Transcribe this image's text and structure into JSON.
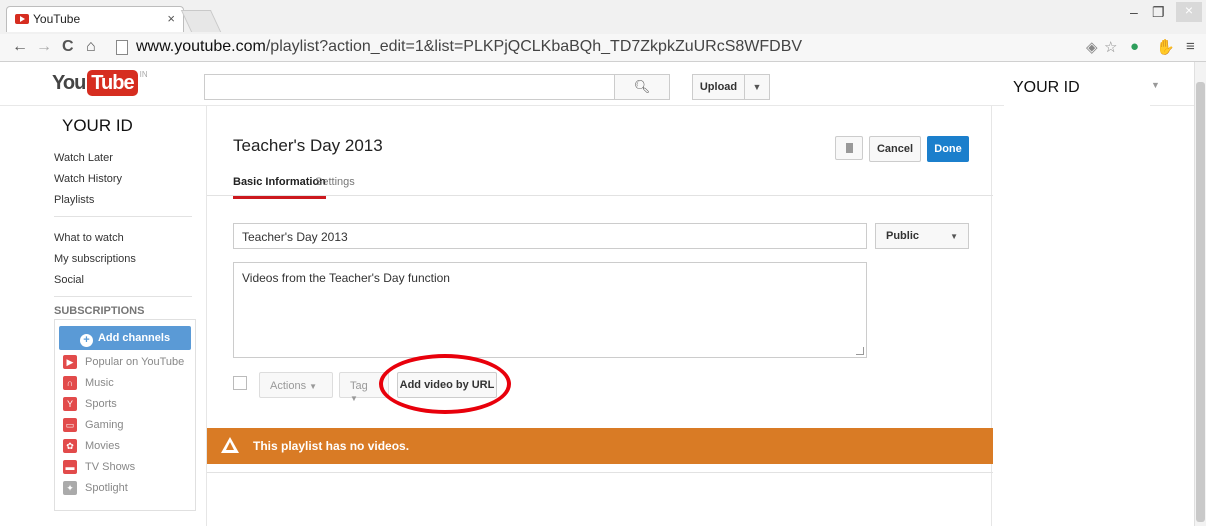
{
  "browser": {
    "tab_title": "YouTube",
    "tab_close": "×",
    "url_host": "www.youtube.com",
    "url_path": "/playlist?action_edit=1&list=PLKPjQCLKbaBQh_TD7ZkpkZuURcS8WFDBV",
    "minimize": "–",
    "restore": "❐",
    "close": "×"
  },
  "header": {
    "logo_you": "You",
    "logo_tube": "Tube",
    "logo_country": "IN",
    "search_value": "",
    "upload_label": "Upload",
    "user_id": "YOUR ID"
  },
  "sidebar": {
    "user_id": "YOUR ID",
    "library": [
      "Watch Later",
      "Watch History",
      "Playlists"
    ],
    "guide": [
      "What to watch",
      "My subscriptions",
      "Social"
    ],
    "subscriptions_title": "SUBSCRIPTIONS",
    "add_channels_label": "Add channels",
    "channels": [
      {
        "label": "Popular on YouTube",
        "color": "#e24b4b",
        "icon": "popular-icon"
      },
      {
        "label": "Music",
        "color": "#e24b4b",
        "icon": "headphones-icon"
      },
      {
        "label": "Sports",
        "color": "#e24b4b",
        "icon": "trophy-icon"
      },
      {
        "label": "Gaming",
        "color": "#e24b4b",
        "icon": "gamepad-icon"
      },
      {
        "label": "Movies",
        "color": "#e24b4b",
        "icon": "film-reel-icon"
      },
      {
        "label": "TV Shows",
        "color": "#e24b4b",
        "icon": "tv-icon"
      },
      {
        "label": "Spotlight",
        "color": "#aaaaaa",
        "icon": "spotlight-icon"
      }
    ]
  },
  "playlist": {
    "title": "Teacher's Day 2013",
    "cancel_label": "Cancel",
    "done_label": "Done",
    "tabs": [
      "Basic Information",
      "Settings"
    ],
    "title_field_value": "Teacher's Day 2013",
    "privacy_value": "Public",
    "description_value": "Videos from the Teacher's Day function",
    "actions_label": "Actions",
    "tag_label": "Tag",
    "add_url_label": "Add video by URL",
    "empty_message": "This playlist has no videos."
  },
  "colors": {
    "brand_red": "#d62d20",
    "done_blue": "#1b7fcc",
    "warning_orange": "#d97b25",
    "annotation_red": "#e8000b"
  }
}
